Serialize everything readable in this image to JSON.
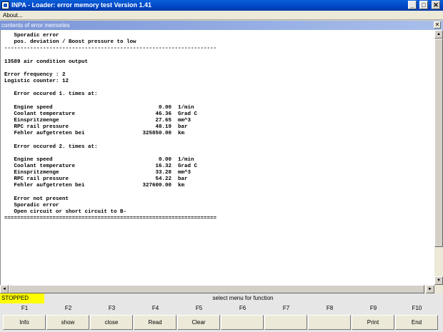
{
  "window": {
    "title": "INPA - Loader:  error memory test  Version 1.41",
    "minimize_glyph": "_",
    "maximize_glyph": "□",
    "close_glyph": "✕"
  },
  "menu": {
    "items": [
      {
        "label": "About..."
      }
    ]
  },
  "panel": {
    "title": "contents of error memories",
    "close_glyph": "✕"
  },
  "content": {
    "lines": [
      "   Sporadic error",
      "   pos. deviation / Boost pressure to low",
      "------------------------------------------------------------------",
      "",
      "13589 air condition output",
      "",
      "Error frequency : 2",
      "Logistic counter: 12",
      "",
      "   Error occured 1. times at:",
      "",
      "   Engine speed                                 0.00  1/min",
      "   Coolant temperature                         46.36  Grad C",
      "   Einspritzmenge                              27.65  mm^3",
      "   RPC rail pressure                           48.19  bar",
      "   Fehler aufgetreten bei                  325850.00  km",
      "",
      "   Error occured 2. times at:",
      "",
      "   Engine speed                                 0.00  1/min",
      "   Coolant temperature                         16.32  Grad C",
      "   Einspritzmenge                              33.28  mm^3",
      "   RPC rail pressure                           54.22  bar",
      "   Fehler aufgetreten bei                  327600.00  km",
      "",
      "   Error not present",
      "   Sporadic error",
      "   Open circuit or short circuit to B-",
      "=================================================================="
    ]
  },
  "scrollbars": {
    "up_glyph": "▲",
    "down_glyph": "▼",
    "left_glyph": "◄",
    "right_glyph": "►"
  },
  "status": {
    "state": "STOPPED",
    "message": "select menu for function",
    "state_color": "#ffff00"
  },
  "function_keys": [
    {
      "key": "F1",
      "label": "Info"
    },
    {
      "key": "F2",
      "label": "show"
    },
    {
      "key": "F3",
      "label": "close"
    },
    {
      "key": "F4",
      "label": "Read"
    },
    {
      "key": "F5",
      "label": "Clear"
    },
    {
      "key": "F6",
      "label": ""
    },
    {
      "key": "F7",
      "label": ""
    },
    {
      "key": "F8",
      "label": ""
    },
    {
      "key": "F9",
      "label": "Print"
    },
    {
      "key": "F10",
      "label": "End"
    }
  ]
}
